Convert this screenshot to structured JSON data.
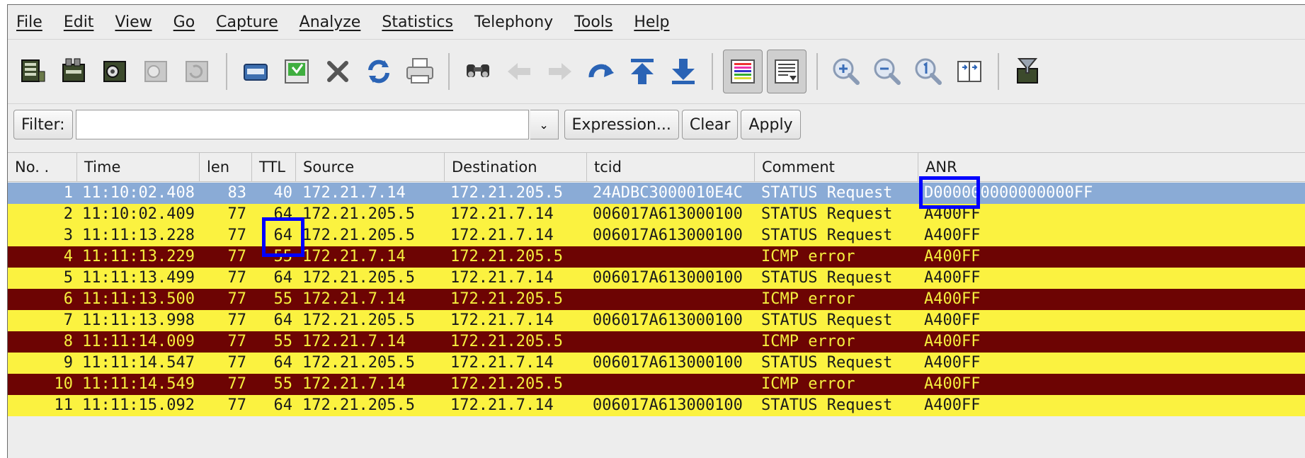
{
  "menu": [
    "File",
    "Edit",
    "View",
    "Go",
    "Capture",
    "Analyze",
    "Statistics",
    "Telephony",
    "Tools",
    "Help"
  ],
  "toolbar_icons": [
    "interfaces-icon",
    "options-icon",
    "start-capture-icon",
    "stop-capture-icon",
    "restart-capture-icon",
    "open-file-icon",
    "save-file-icon",
    "close-file-icon",
    "reload-icon",
    "print-icon",
    "find-packet-icon",
    "go-back-icon",
    "go-forward-icon",
    "go-to-packet-icon",
    "first-packet-icon",
    "last-packet-icon",
    "colorize-icon",
    "autoscroll-icon",
    "zoom-in-icon",
    "zoom-out-icon",
    "normal-size-icon",
    "resize-columns-icon",
    "capture-filters-icon"
  ],
  "filter": {
    "label": "Filter:",
    "value": "",
    "expression_label": "Expression...",
    "clear_label": "Clear",
    "apply_label": "Apply"
  },
  "columns": [
    "No. .",
    "Time",
    "len",
    "TTL",
    "Source",
    "Destination",
    "tcid",
    "Comment",
    "ANR"
  ],
  "packets": [
    {
      "no": "1",
      "time": "11:10:02.408",
      "len": "83",
      "ttl": "40",
      "source": "172.21.7.14",
      "destination": "172.21.205.5",
      "tcid": "24ADBC3000010E4C",
      "comment": "STATUS Request",
      "anr": "D000000000000000FF"
    },
    {
      "no": "2",
      "time": "11:10:02.409",
      "len": "77",
      "ttl": "64",
      "source": "172.21.205.5",
      "destination": "172.21.7.14",
      "tcid": "006017A613000100",
      "comment": "STATUS Request",
      "anr": "A400FF"
    },
    {
      "no": "3",
      "time": "11:11:13.228",
      "len": "77",
      "ttl": "64",
      "source": "172.21.205.5",
      "destination": "172.21.7.14",
      "tcid": "006017A613000100",
      "comment": "STATUS Request",
      "anr": "A400FF"
    },
    {
      "no": "4",
      "time": "11:11:13.229",
      "len": "77",
      "ttl": "55",
      "source": "172.21.7.14",
      "destination": "172.21.205.5",
      "tcid": "",
      "comment": "ICMP error",
      "anr": "A400FF"
    },
    {
      "no": "5",
      "time": "11:11:13.499",
      "len": "77",
      "ttl": "64",
      "source": "172.21.205.5",
      "destination": "172.21.7.14",
      "tcid": "006017A613000100",
      "comment": "STATUS Request",
      "anr": "A400FF"
    },
    {
      "no": "6",
      "time": "11:11:13.500",
      "len": "77",
      "ttl": "55",
      "source": "172.21.7.14",
      "destination": "172.21.205.5",
      "tcid": "",
      "comment": "ICMP error",
      "anr": "A400FF"
    },
    {
      "no": "7",
      "time": "11:11:13.998",
      "len": "77",
      "ttl": "64",
      "source": "172.21.205.5",
      "destination": "172.21.7.14",
      "tcid": "006017A613000100",
      "comment": "STATUS Request",
      "anr": "A400FF"
    },
    {
      "no": "8",
      "time": "11:11:14.009",
      "len": "77",
      "ttl": "55",
      "source": "172.21.7.14",
      "destination": "172.21.205.5",
      "tcid": "",
      "comment": "ICMP error",
      "anr": "A400FF"
    },
    {
      "no": "9",
      "time": "11:11:14.547",
      "len": "77",
      "ttl": "64",
      "source": "172.21.205.5",
      "destination": "172.21.7.14",
      "tcid": "006017A613000100",
      "comment": "STATUS Request",
      "anr": "A400FF"
    },
    {
      "no": "10",
      "time": "11:11:14.549",
      "len": "77",
      "ttl": "55",
      "source": "172.21.7.14",
      "destination": "172.21.205.5",
      "tcid": "",
      "comment": "ICMP error",
      "anr": "A400FF"
    },
    {
      "no": "11",
      "time": "11:11:15.092",
      "len": "77",
      "ttl": "64",
      "source": "172.21.205.5",
      "destination": "172.21.7.14",
      "tcid": "006017A613000100",
      "comment": "STATUS Request",
      "anr": "A400FF"
    }
  ],
  "colors": {
    "selected_row": "#8aabd6",
    "status_row": "#fbf240",
    "icmp_row": "#6d0403",
    "icmp_text": "#f6ef3e",
    "highlight_box": "#0000ff"
  }
}
